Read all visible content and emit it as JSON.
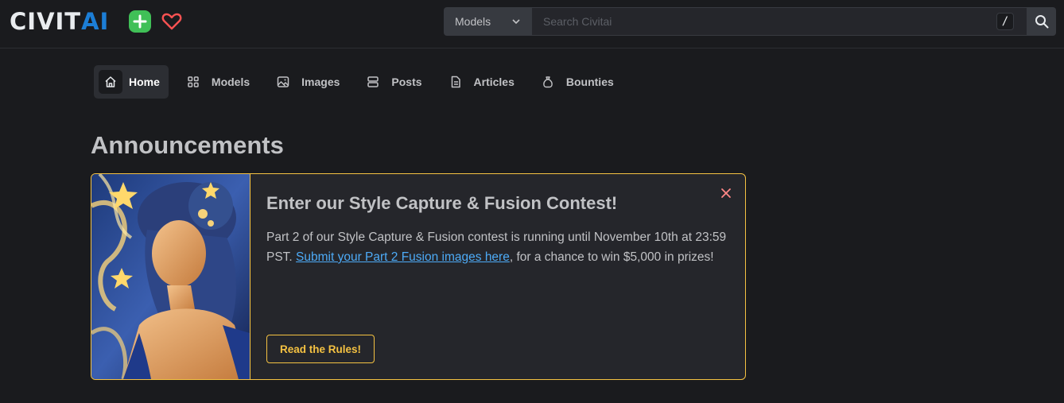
{
  "header": {
    "logo": {
      "part1": "CIVIT",
      "part2": "AI"
    },
    "search": {
      "category": "Models",
      "placeholder": "Search Civitai",
      "shortcut": "/"
    }
  },
  "nav": [
    {
      "label": "Home",
      "icon": "home-icon",
      "active": true
    },
    {
      "label": "Models",
      "icon": "grid-icon"
    },
    {
      "label": "Images",
      "icon": "photo-icon"
    },
    {
      "label": "Posts",
      "icon": "posts-icon"
    },
    {
      "label": "Articles",
      "icon": "article-icon"
    },
    {
      "label": "Bounties",
      "icon": "moneybag-icon"
    }
  ],
  "announcements": {
    "heading": "Announcements",
    "card": {
      "title": "Enter our Style Capture & Fusion Contest!",
      "body_before": "Part 2 of our Style Capture & Fusion contest is running until November 10th at 23:59 PST. ",
      "link_text": "Submit your Part 2 Fusion images here",
      "body_after": ", for a chance to win $5,000 in prizes!",
      "button_label": "Read the Rules!"
    }
  },
  "colors": {
    "background": "#1a1b1e",
    "accent_gold": "#f5c242",
    "brand_blue": "#1c7ed6",
    "plus_green": "#40c057",
    "heart_red": "#fa5252",
    "link_blue": "#4dabf7"
  }
}
